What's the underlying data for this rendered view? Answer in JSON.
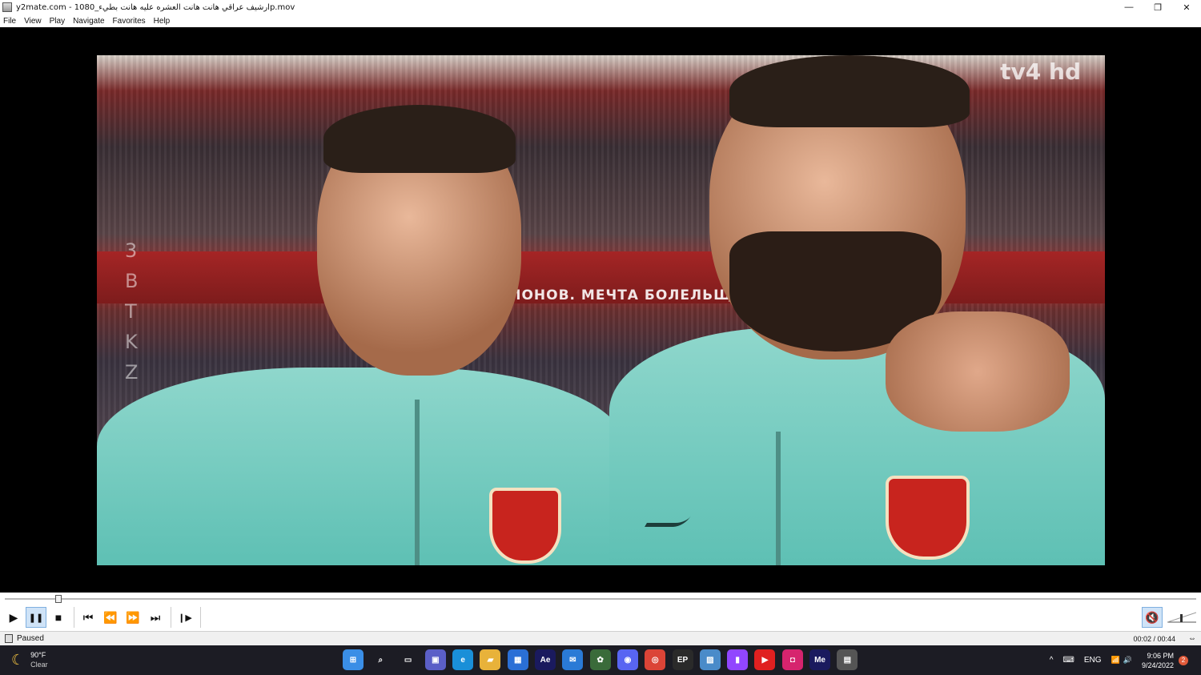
{
  "titlebar": {
    "title": "y2mate.com - ارشيف عراقي هانت هانت العشره عليه هانت  بطيء_1080p.mov",
    "minimize_icon": "minimize-icon",
    "restore_icon": "restore-icon",
    "close_icon": "close-icon"
  },
  "menu": {
    "items": [
      "File",
      "View",
      "Play",
      "Navigate",
      "Favorites",
      "Help"
    ]
  },
  "video": {
    "channel_logo": "tv4 hd",
    "banner_text": "ПИОНОВ. МЕЧТА БОЛЕЛЬЩИКО",
    "watermark_letters": [
      "3",
      "B",
      "T",
      "K",
      "Z"
    ]
  },
  "seek": {
    "progress": 0.045
  },
  "toolbar": {
    "play_icon": "▶",
    "pause_icon": "❚❚",
    "stop_icon": "■",
    "prev_icon": "⏮",
    "rewind_icon": "⏪",
    "forward_icon": "⏩",
    "next_icon": "⏭",
    "frame_step_icon": "❙▶",
    "mute_icon": "🔇"
  },
  "status": {
    "state": "Paused",
    "time": "00:02 / 00:44"
  },
  "taskbar": {
    "weather_temp": "90°F",
    "weather_cond": "Clear",
    "apps": [
      {
        "name": "start",
        "label": "⊞",
        "color": "#3a8ee6"
      },
      {
        "name": "search",
        "label": "⌕",
        "color": "#1c1c24"
      },
      {
        "name": "task-view",
        "label": "▭",
        "color": "#1c1c24"
      },
      {
        "name": "chat",
        "label": "▣",
        "color": "#5b5fc7"
      },
      {
        "name": "edge",
        "label": "e",
        "color": "#1a8fd8"
      },
      {
        "name": "explorer",
        "label": "▰",
        "color": "#e8b23a"
      },
      {
        "name": "store",
        "label": "▦",
        "color": "#2a6fd6"
      },
      {
        "name": "after-effects",
        "label": "Ae",
        "color": "#1a1a5e"
      },
      {
        "name": "mail",
        "label": "✉",
        "color": "#2a7ad6"
      },
      {
        "name": "app-unknown",
        "label": "✿",
        "color": "#3a6b3a"
      },
      {
        "name": "discord",
        "label": "◉",
        "color": "#5865f2"
      },
      {
        "name": "chrome",
        "label": "◎",
        "color": "#db4437"
      },
      {
        "name": "epic",
        "label": "EP",
        "color": "#2a2a2a"
      },
      {
        "name": "photos",
        "label": "▨",
        "color": "#4a8bc9"
      },
      {
        "name": "twitch",
        "label": "▮",
        "color": "#9146ff"
      },
      {
        "name": "youtube",
        "label": "▶",
        "color": "#e02020"
      },
      {
        "name": "instagram",
        "label": "◘",
        "color": "#d6246e"
      },
      {
        "name": "media-encoder",
        "label": "Me",
        "color": "#1a1a5e"
      },
      {
        "name": "media-player",
        "label": "▤",
        "color": "#555555"
      }
    ],
    "tray_caret": "^",
    "keyboard_icon": "⌨",
    "language": "ENG",
    "wifi_icon": "📶",
    "volume_icon": "🔊",
    "time": "9:06 PM",
    "date": "9/24/2022",
    "notifications": "2"
  }
}
